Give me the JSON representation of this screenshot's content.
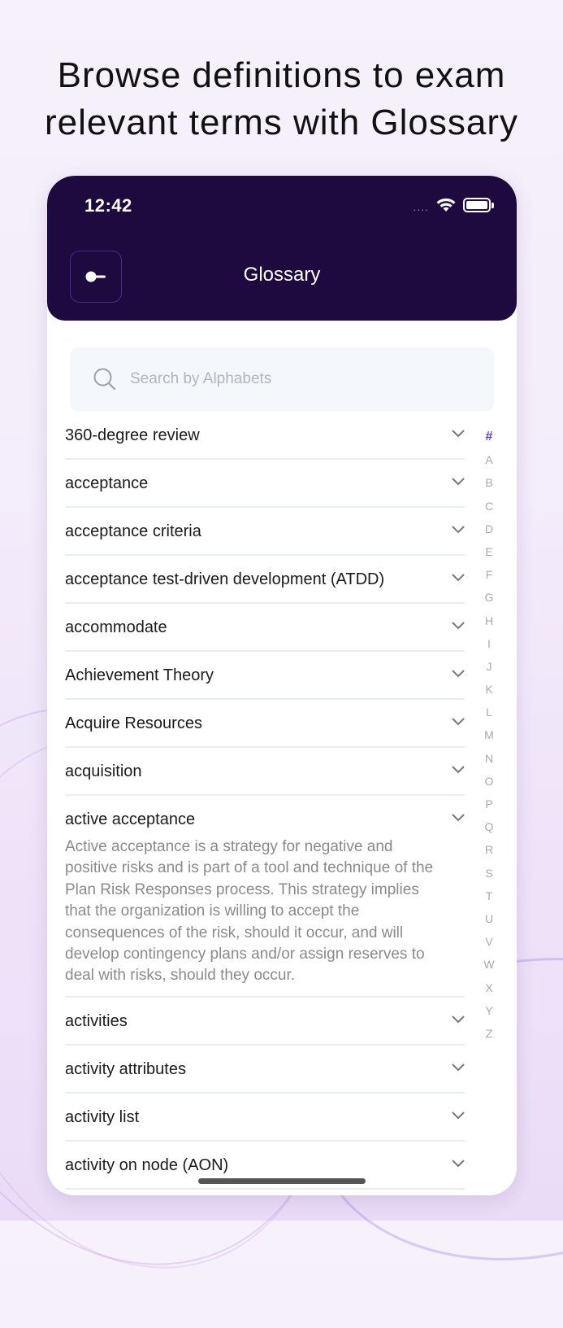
{
  "headline": "Browse definitions to exam relevant terms with Glossary",
  "status_bar": {
    "time": "12:42",
    "dots": "....",
    "wifi_icon": "wifi-icon",
    "battery_icon": "battery-icon"
  },
  "header": {
    "title": "Glossary",
    "back_icon": "back-arrow-icon"
  },
  "search": {
    "placeholder": "Search by Alphabets",
    "icon": "search-icon"
  },
  "terms": [
    {
      "term": "360-degree review"
    },
    {
      "term": "acceptance"
    },
    {
      "term": "acceptance criteria"
    },
    {
      "term": "acceptance test-driven development (ATDD)"
    },
    {
      "term": "accommodate"
    },
    {
      "term": "Achievement Theory"
    },
    {
      "term": "Acquire Resources"
    },
    {
      "term": "acquisition"
    },
    {
      "term": "active acceptance",
      "definition": "Active acceptance is a strategy for negative and positive risks and is part of a tool and technique of the Plan Risk Responses process. This strategy implies that the organization is willing to accept the consequences of the risk, should it occur, and will develop contingency plans and/or assign reserves to deal with risks, should they occur."
    },
    {
      "term": "activities"
    },
    {
      "term": "activity attributes"
    },
    {
      "term": "activity list"
    },
    {
      "term": "activity on node (AON)"
    }
  ],
  "alphabet": [
    "#",
    "A",
    "B",
    "C",
    "D",
    "E",
    "F",
    "G",
    "H",
    "I",
    "J",
    "K",
    "L",
    "M",
    "N",
    "O",
    "P",
    "Q",
    "R",
    "S",
    "T",
    "U",
    "V",
    "W",
    "X",
    "Y",
    "Z"
  ],
  "active_letter": "#",
  "colors": {
    "header_bg": "#1f0a40",
    "accent": "#5c3bc4"
  }
}
